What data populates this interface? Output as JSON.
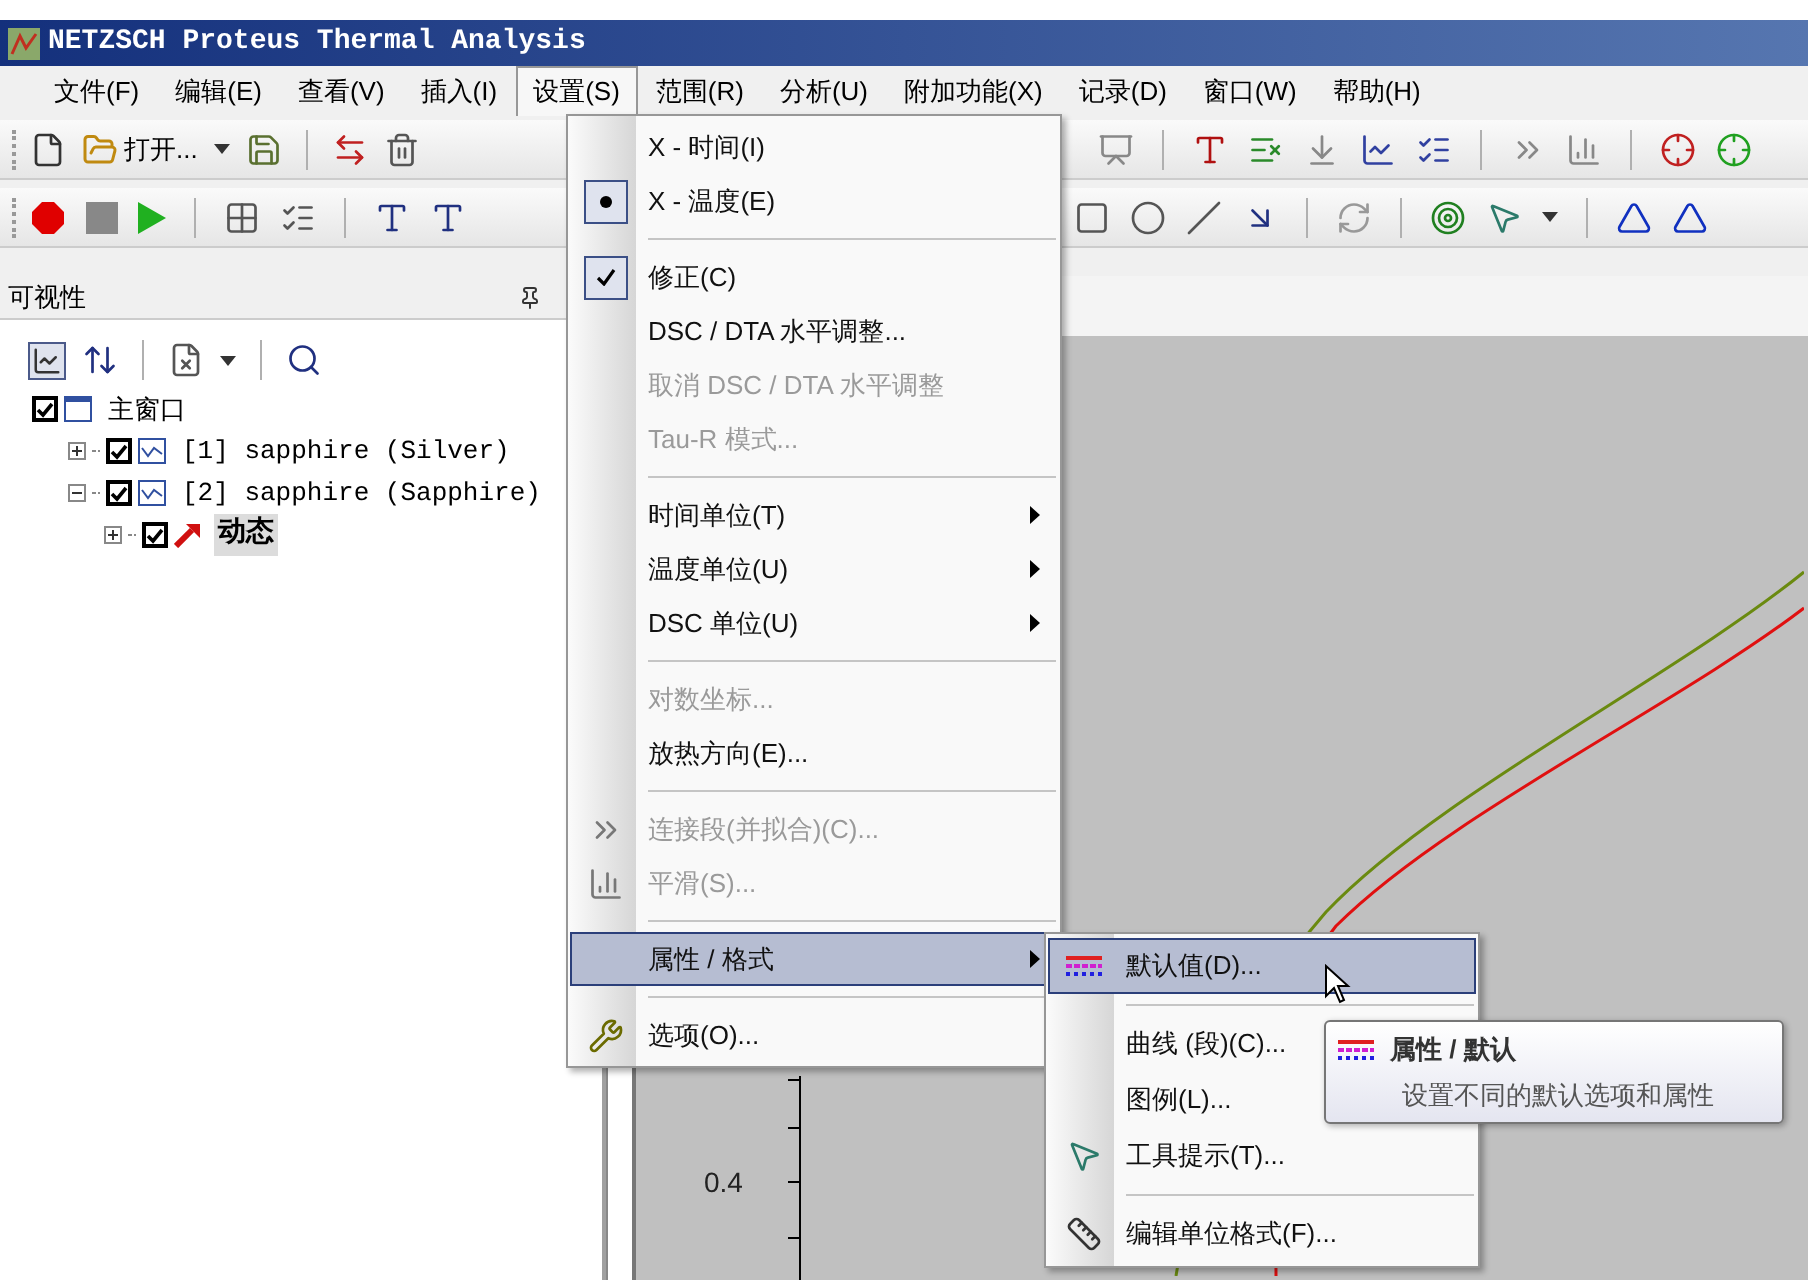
{
  "window": {
    "title": "NETZSCH Proteus Thermal Analysis"
  },
  "menubar": [
    {
      "label": "文件(F)",
      "selected": false
    },
    {
      "label": "编辑(E)",
      "selected": false
    },
    {
      "label": "查看(V)",
      "selected": false
    },
    {
      "label": "插入(I)",
      "selected": false
    },
    {
      "label": "设置(S)",
      "selected": true
    },
    {
      "label": "范围(R)",
      "selected": false
    },
    {
      "label": "分析(U)",
      "selected": false
    },
    {
      "label": "附加功能(X)",
      "selected": false
    },
    {
      "label": "记录(D)",
      "selected": false
    },
    {
      "label": "窗口(W)",
      "selected": false
    },
    {
      "label": "帮助(H)",
      "selected": false
    }
  ],
  "toolbar": {
    "open_button": "打开..."
  },
  "panel": {
    "title": "可视性",
    "tree": [
      {
        "label": "主窗口",
        "checked": true,
        "selected": false,
        "children": [
          {
            "label": "[1] sapphire (Silver)",
            "checked": true,
            "expanded": false,
            "selected": false
          },
          {
            "label": "[2] sapphire (Sapphire)",
            "checked": true,
            "expanded": true,
            "selected": false,
            "children": [
              {
                "label": "动态",
                "checked": true,
                "expanded": false,
                "selected": true
              }
            ]
          }
        ]
      }
    ]
  },
  "plot": {
    "tick_label": "0.4"
  },
  "settings_menu": [
    {
      "kind": "radio",
      "label": "X - 时间(I)",
      "checked": false,
      "disabled": false,
      "selected": false
    },
    {
      "kind": "radio",
      "label": "X - 温度(E)",
      "checked": true,
      "disabled": false,
      "selected": false
    },
    {
      "kind": "separator"
    },
    {
      "kind": "check",
      "label": "修正(C)",
      "checked": true,
      "disabled": false,
      "selected": false
    },
    {
      "kind": "command",
      "label": "DSC / DTA 水平调整...",
      "disabled": false,
      "selected": false
    },
    {
      "kind": "command",
      "label": "取消 DSC / DTA 水平调整",
      "disabled": true,
      "selected": false
    },
    {
      "kind": "command",
      "label": "Tau-R 模式...",
      "disabled": true,
      "selected": false
    },
    {
      "kind": "separator"
    },
    {
      "kind": "submenu",
      "label": "时间单位(T)",
      "disabled": false,
      "selected": false
    },
    {
      "kind": "submenu",
      "label": "温度单位(U)",
      "disabled": false,
      "selected": false
    },
    {
      "kind": "submenu",
      "label": "DSC 单位(U)",
      "disabled": false,
      "selected": false
    },
    {
      "kind": "separator"
    },
    {
      "kind": "command",
      "label": "对数坐标...",
      "disabled": true,
      "selected": false
    },
    {
      "kind": "command",
      "label": "放热方向(E)...",
      "disabled": false,
      "selected": false
    },
    {
      "kind": "separator"
    },
    {
      "kind": "command",
      "label": "连接段(并拟合)(C)...",
      "disabled": true,
      "selected": false
    },
    {
      "kind": "command",
      "label": "平滑(S)...",
      "disabled": true,
      "selected": false
    },
    {
      "kind": "separator"
    },
    {
      "kind": "submenu",
      "label": "属性 / 格式",
      "disabled": false,
      "selected": true
    },
    {
      "kind": "separator"
    },
    {
      "kind": "command",
      "label": "选项(O)...",
      "disabled": false,
      "selected": false
    }
  ],
  "format_submenu": [
    {
      "kind": "command",
      "label": "默认值(D)...",
      "selected": true
    },
    {
      "kind": "separator"
    },
    {
      "kind": "command",
      "label": "曲线 (段)(C)...",
      "selected": false
    },
    {
      "kind": "command",
      "label": "图例(L)...",
      "selected": false
    },
    {
      "kind": "command",
      "label": "工具提示(T)...",
      "selected": false
    },
    {
      "kind": "separator"
    },
    {
      "kind": "command",
      "label": "编辑单位格式(F)...",
      "selected": false
    }
  ],
  "tooltip": {
    "title": "属性 / 默认",
    "text": "设置不同的默认选项和属性"
  }
}
